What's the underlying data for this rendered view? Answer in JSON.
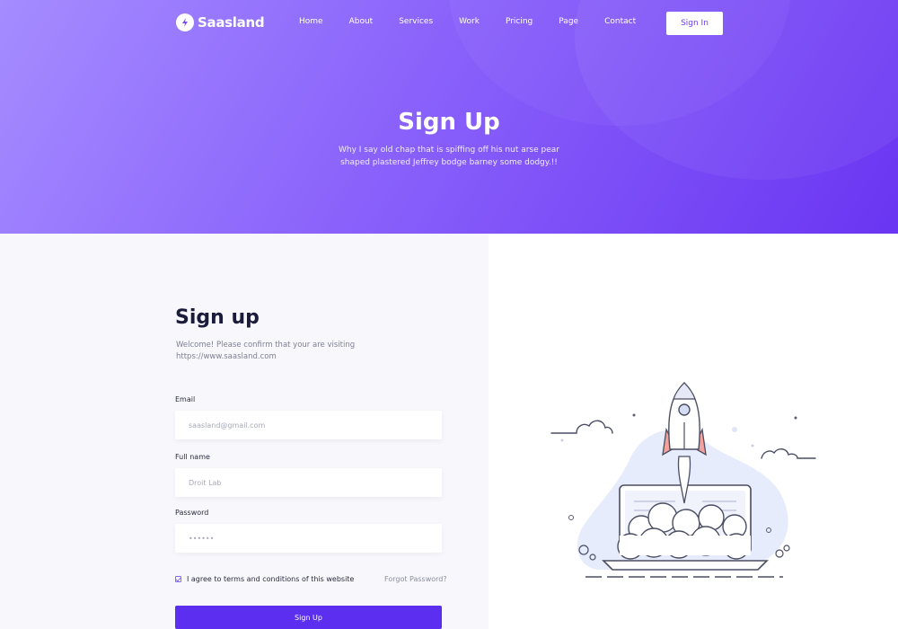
{
  "brand": {
    "name": "Saasland"
  },
  "nav": {
    "items": [
      "Home",
      "About",
      "Services",
      "Work",
      "Pricing",
      "Page",
      "Contact"
    ],
    "signin_label": "Sign In"
  },
  "hero": {
    "title": "Sign Up",
    "subtitle": "Why I say old chap that is spiffing off his nut arse pear shaped plastered Jeffrey bodge barney some dodgy.!!"
  },
  "form": {
    "title": "Sign up",
    "subtitle": "Welcome! Please confirm that your are visiting https://www.saasland.com",
    "email_label": "Email",
    "email_placeholder": "saasland@gmail.com",
    "fullname_label": "Full name",
    "fullname_placeholder": "Droit Lab",
    "password_label": "Password",
    "password_placeholder": "••••••",
    "agree_text": "I agree to terms and conditions of this website",
    "agree_checked": true,
    "forgot_label": "Forgot Password?",
    "submit_label": "Sign Up"
  },
  "colors": {
    "accent": "#5b2ef0",
    "hero_start": "#a58cff",
    "hero_end": "#6a35f2",
    "illustration_blob": "#e6ecfb",
    "rocket_fin": "#f4a29b"
  },
  "icons": {
    "logo": "lightning-bolt-icon",
    "illustration": "rocket-launch-laptop-illustration"
  }
}
